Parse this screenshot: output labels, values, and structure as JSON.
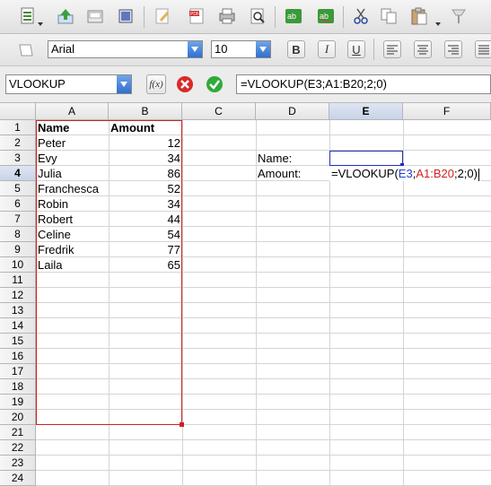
{
  "toolbar": {
    "font_name": "Arial",
    "font_size": "10",
    "bold_label": "B",
    "italic_label": "I",
    "underline_label": "U"
  },
  "formula_bar": {
    "name_box": "VLOOKUP",
    "function_icon": "f(x)",
    "formula": "=VLOOKUP(E3;A1:B20;2;0)"
  },
  "columns": [
    "A",
    "B",
    "C",
    "D",
    "E",
    "F"
  ],
  "rows": [
    "1",
    "2",
    "3",
    "4",
    "5",
    "6",
    "7",
    "8",
    "9",
    "10",
    "11",
    "12",
    "13",
    "14",
    "15",
    "16",
    "17",
    "18",
    "19",
    "20",
    "21",
    "22",
    "23",
    "24"
  ],
  "table": {
    "header_name": "Name",
    "header_amount": "Amount",
    "names": [
      "Peter",
      "Evy",
      "Julia",
      "Franchesca",
      "Robin",
      "Robert",
      "Celine",
      "Fredrik",
      "Laila"
    ],
    "amounts": [
      "12",
      "34",
      "86",
      "52",
      "34",
      "44",
      "54",
      "77",
      "65"
    ]
  },
  "lookup": {
    "name_label": "Name:",
    "amount_label": "Amount:",
    "formula_prefix": "=VLOOKUP(",
    "ref1": "E3",
    "sep1": ";",
    "ref2": "A1:B20",
    "suffix": ";2;0)"
  },
  "colors": {
    "ref1_color": "#1f3fd0",
    "ref2_color": "#d02020",
    "range_border": "#d02020",
    "active_border": "#1f2fb8"
  }
}
